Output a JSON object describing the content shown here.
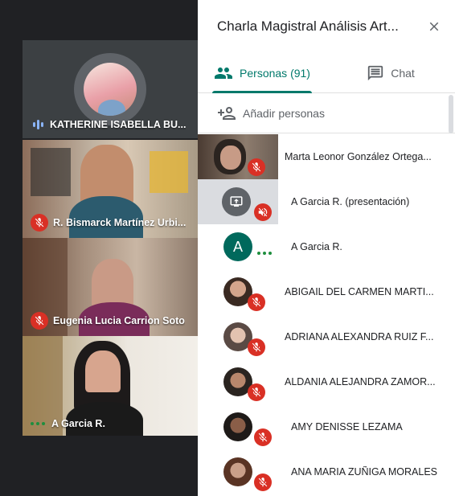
{
  "tiles": [
    {
      "name": "KATHERINE ISABELLA BU...",
      "status": "speaking"
    },
    {
      "name": "R. Bismarck Martínez Urbi...",
      "status": "muted"
    },
    {
      "name": "Eugenia Lucia Carrion Soto",
      "status": "muted"
    },
    {
      "name": "A Garcia R.",
      "status": "active"
    }
  ],
  "panel": {
    "title": "Charla Magistral Análisis Art...",
    "tabs": [
      {
        "label": "Personas (91)",
        "icon": "people-icon",
        "active": true
      },
      {
        "label": "Chat",
        "icon": "chat-icon",
        "active": false
      }
    ],
    "add_people": "Añadir personas"
  },
  "participants": [
    {
      "name": "Marta Leonor González Ortega...",
      "status": "muted",
      "avatar": "video"
    },
    {
      "name": "A Garcia R. (presentación)",
      "status": "muted",
      "avatar": "presentation"
    },
    {
      "name": "A Garcia R.",
      "status": "active",
      "avatar": "letter",
      "initial": "A"
    },
    {
      "name": "ABIGAIL DEL CARMEN MARTI...",
      "status": "muted",
      "avatar": "photo"
    },
    {
      "name": "ADRIANA ALEXANDRA RUIZ F...",
      "status": "muted",
      "avatar": "photo"
    },
    {
      "name": "ALDANIA ALEJANDRA ZAMOR...",
      "status": "muted",
      "avatar": "photo"
    },
    {
      "name": "AMY DENISSE LEZAMA",
      "status": "muted",
      "avatar": "photo"
    },
    {
      "name": "ANA MARIA ZUÑIGA MORALES",
      "status": "muted",
      "avatar": "photo"
    }
  ],
  "colors": {
    "accent": "#00796b",
    "muted": "#d93025",
    "active_dots": "#1e8e3e"
  }
}
